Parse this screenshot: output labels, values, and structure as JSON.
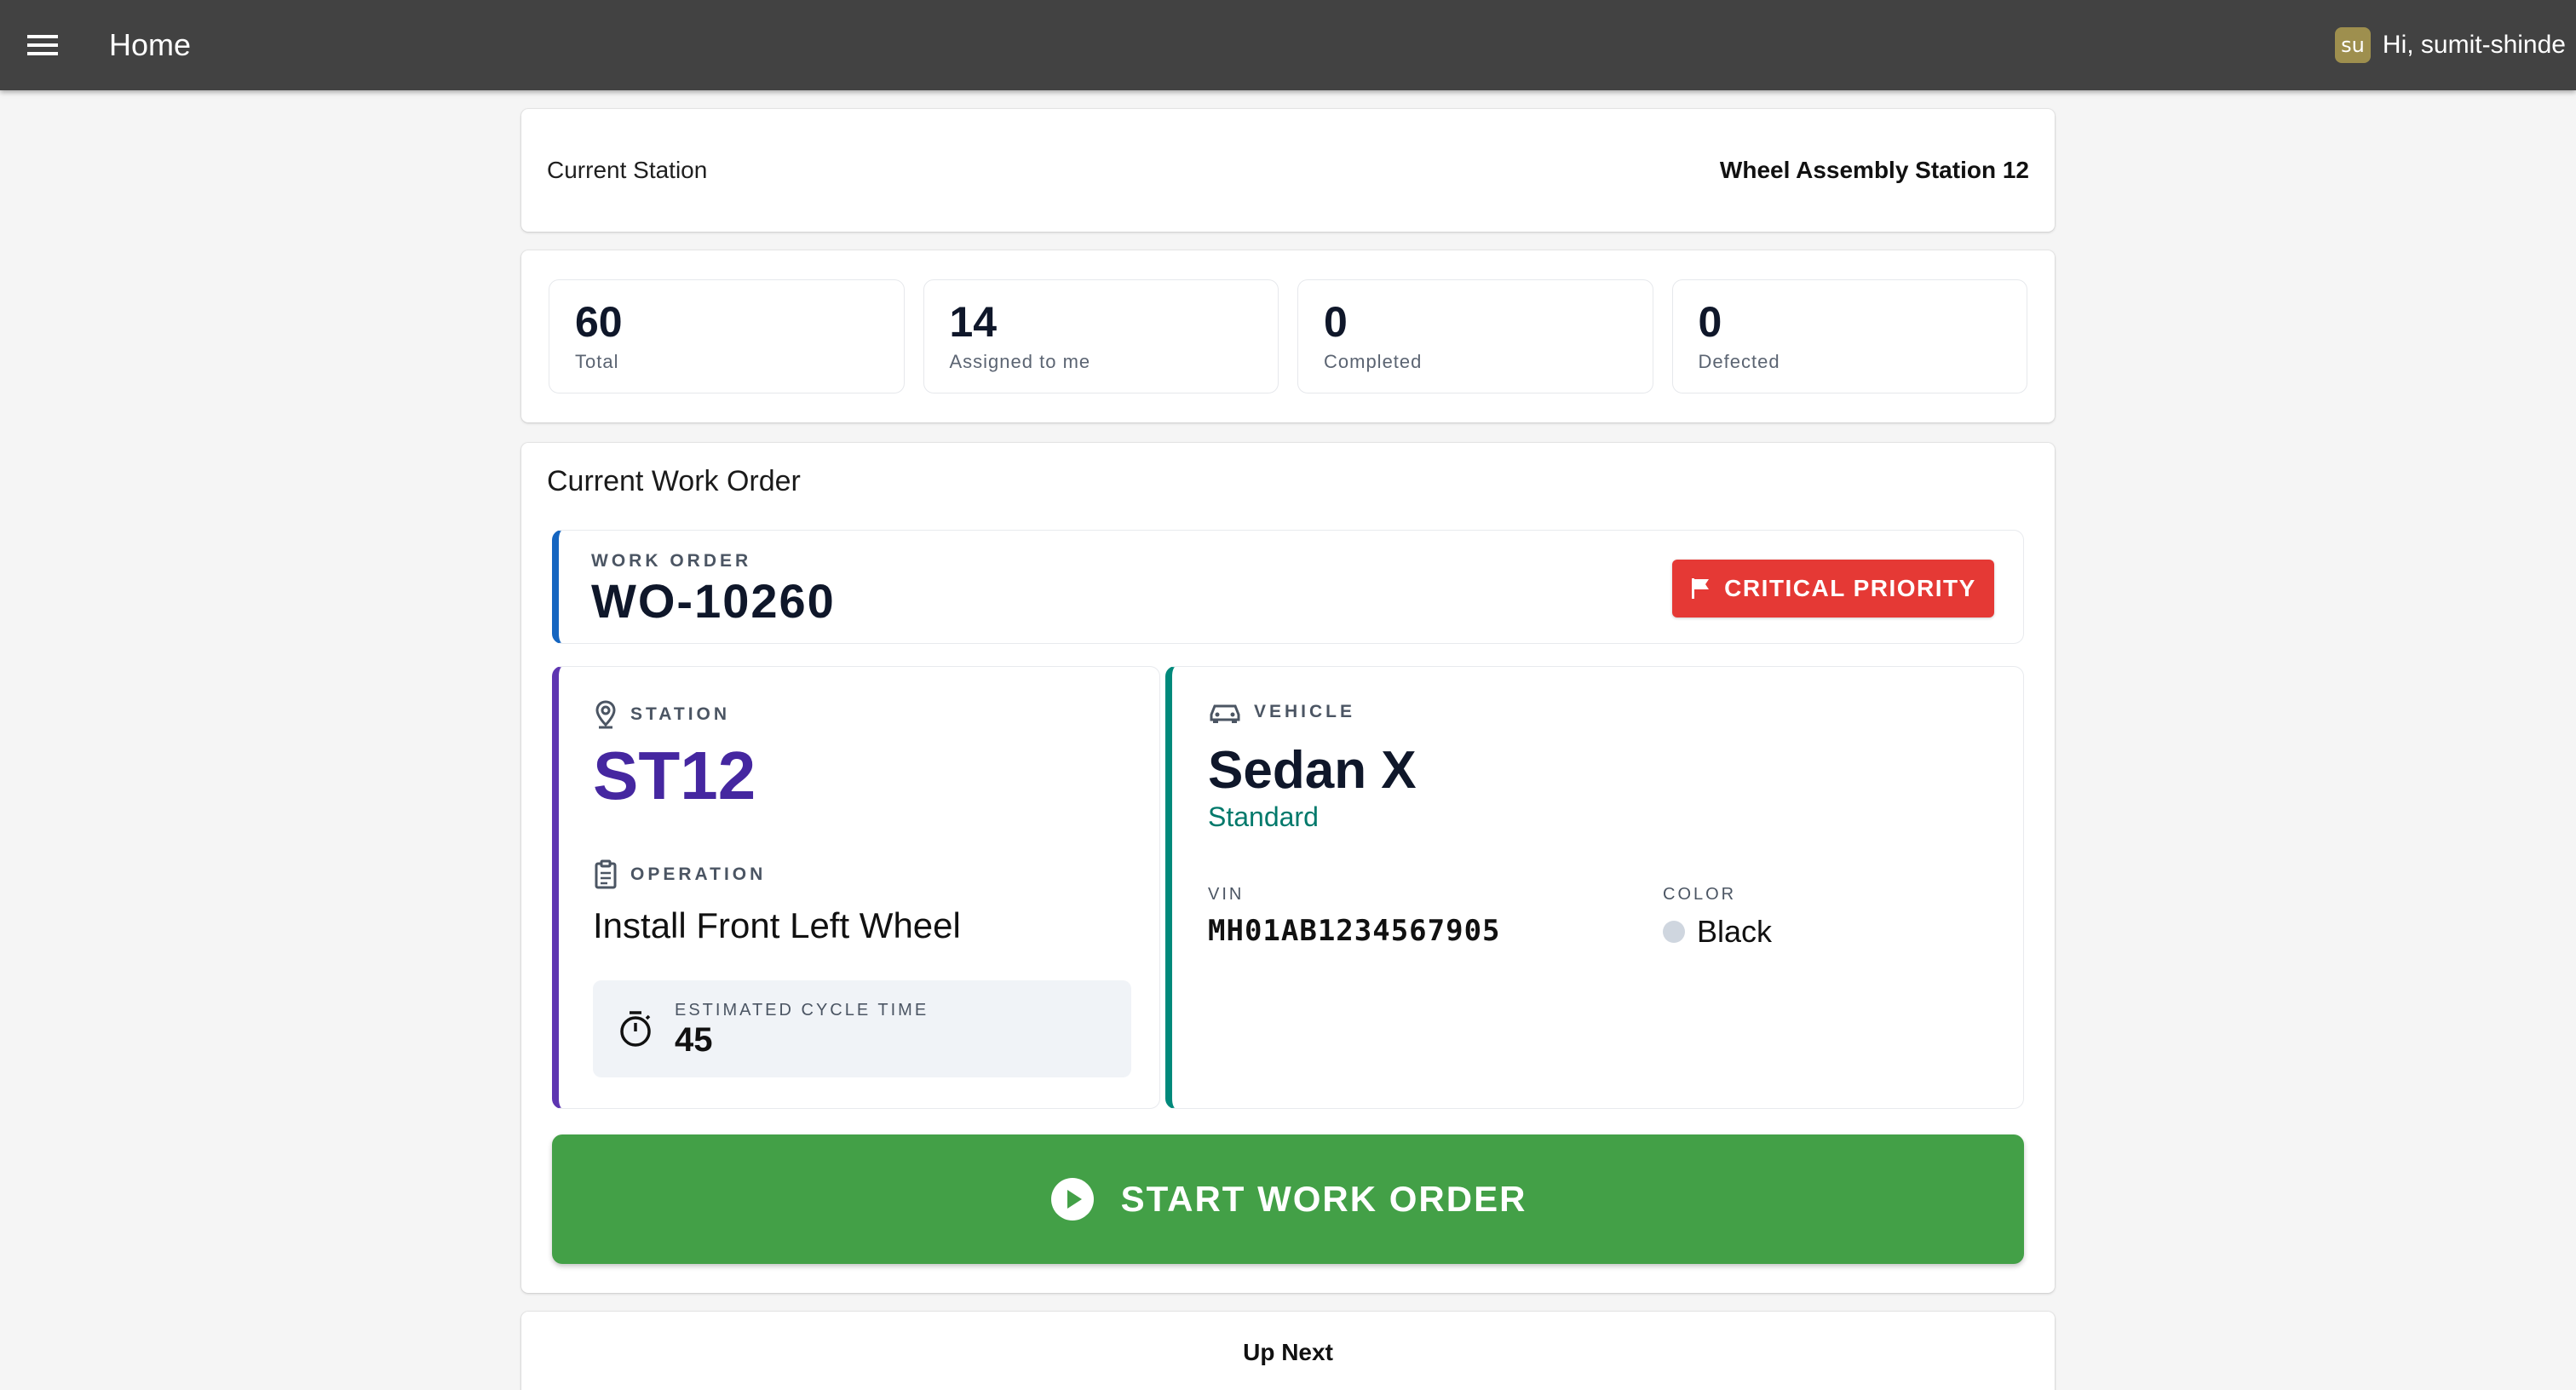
{
  "appbar": {
    "title": "Home",
    "user_initials": "su",
    "greeting": "Hi, sumit-shinde"
  },
  "station": {
    "label": "Current Station",
    "value": "Wheel Assembly Station 12"
  },
  "stats": [
    {
      "value": "60",
      "caption": "Total"
    },
    {
      "value": "14",
      "caption": "Assigned to me"
    },
    {
      "value": "0",
      "caption": "Completed"
    },
    {
      "value": "0",
      "caption": "Defected"
    }
  ],
  "work_order": {
    "heading": "Current Work Order",
    "label": "WORK ORDER",
    "number": "WO-10260",
    "priority": "CRITICAL PRIORITY",
    "station_label": "STATION",
    "station_code": "ST12",
    "operation_label": "OPERATION",
    "operation": "Install Front Left Wheel",
    "cycle_label": "ESTIMATED CYCLE TIME",
    "cycle_value": "45",
    "vehicle_label": "VEHICLE",
    "vehicle_model": "Sedan X",
    "vehicle_trim": "Standard",
    "vin_label": "VIN",
    "vin": "MH01AB1234567905",
    "color_label": "COLOR",
    "color": "Black",
    "start_label": "START WORK ORDER"
  },
  "up_next": {
    "label": "Up Next"
  },
  "colors": {
    "appbar": "#424242",
    "work_order_accent": "#1565c0",
    "station_accent": "#5e35b1",
    "vehicle_accent": "#00897b",
    "priority": "#e53935",
    "start_button": "#43a047"
  }
}
